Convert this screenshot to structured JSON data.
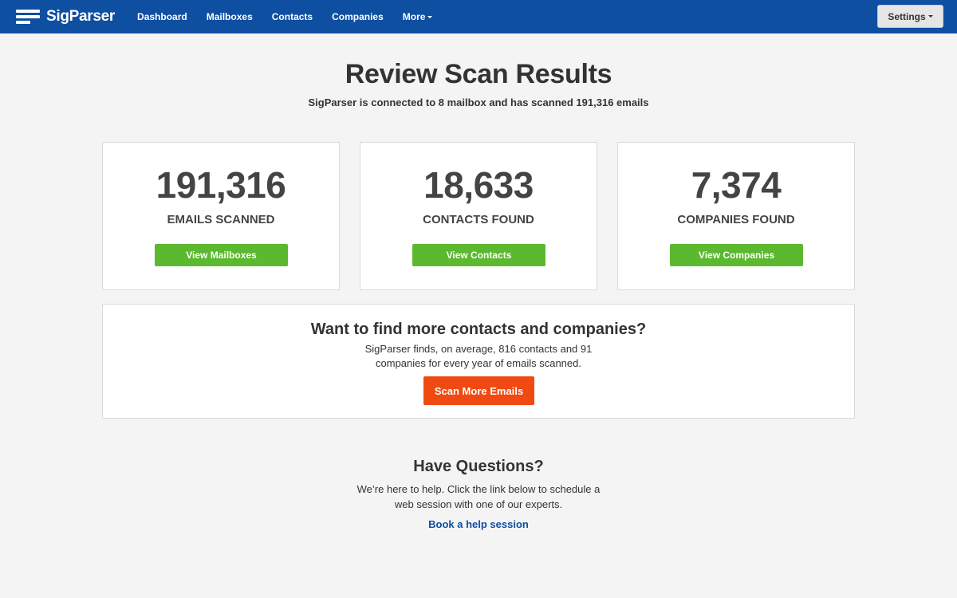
{
  "navbar": {
    "brand": "SigParser",
    "links": [
      "Dashboard",
      "Mailboxes",
      "Contacts",
      "Companies"
    ],
    "more_label": "More",
    "settings_label": "Settings"
  },
  "header": {
    "title": "Review Scan Results",
    "subtitle": "SigParser is connected to 8 mailbox and has scanned 191,316 emails"
  },
  "stats": [
    {
      "number": "191,316",
      "label": "EMAILS SCANNED",
      "button": "View Mailboxes"
    },
    {
      "number": "18,633",
      "label": "CONTACTS FOUND",
      "button": "View Contacts"
    },
    {
      "number": "7,374",
      "label": "COMPANIES FOUND",
      "button": "View Companies"
    }
  ],
  "more": {
    "title": "Want to find more contacts and companies?",
    "line1": "SigParser finds, on average, 816 contacts and 91",
    "line2": "companies for every year of emails scanned.",
    "button": "Scan More Emails"
  },
  "questions": {
    "title": "Have Questions?",
    "line1": "We’re here to help. Click the link below to schedule a",
    "line2": "web session with one of our experts.",
    "link": "Book a help session"
  },
  "colors": {
    "navbar": "#0f4fa1",
    "green_button": "#5cb82e",
    "orange_button": "#f04a12",
    "link": "#0f4fa1"
  }
}
